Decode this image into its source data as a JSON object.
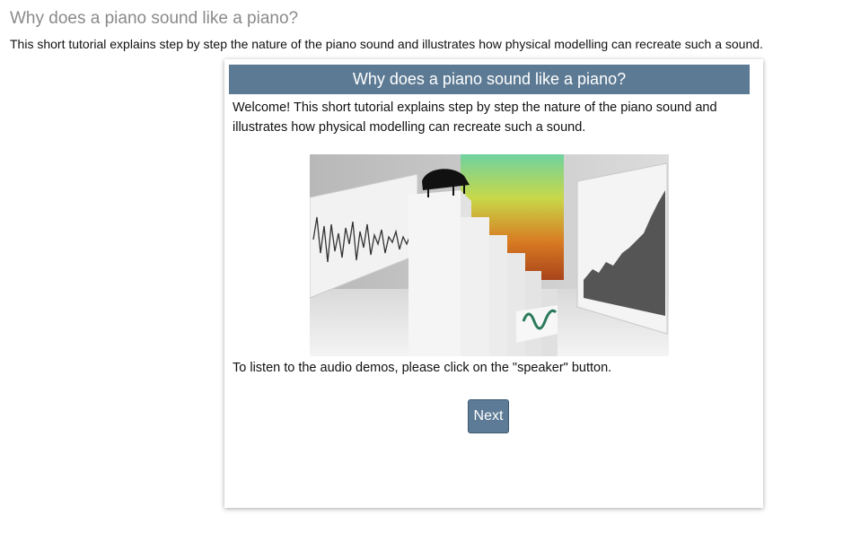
{
  "page": {
    "title": "Why does a piano sound like a piano?",
    "subtitle": "This short tutorial explains step by step the nature of the piano sound and illustrates how physical modelling can recreate such a sound."
  },
  "card": {
    "header": "Why does a piano sound like a piano?",
    "intro": "Welcome! This short tutorial explains step by step the nature of the piano sound and illustrates how physical modelling can recreate such a sound.",
    "audio_note": "To listen to the audio demos, please click on the \"speaker\" button.",
    "next_label": "Next"
  },
  "colors": {
    "header_bg": "#5c7a94",
    "button_bg": "#5d7b96"
  }
}
